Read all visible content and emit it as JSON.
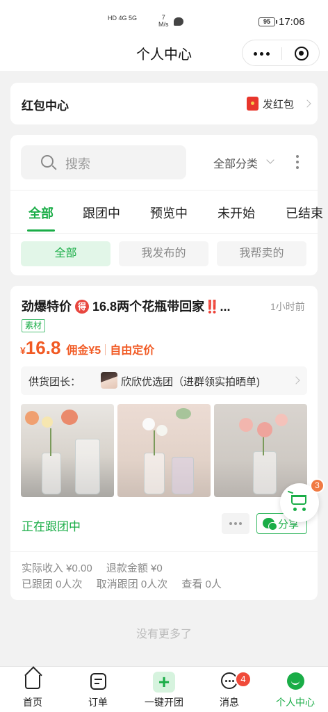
{
  "status_bar": {
    "network": "HD 4G 5G",
    "speed_value": "7",
    "speed_unit": "M/s",
    "battery": "95",
    "time": "17:06"
  },
  "nav": {
    "title": "个人中心",
    "more_icon": "more-dots-icon",
    "close_icon": "target-icon"
  },
  "red_packet": {
    "title": "红包中心",
    "action": "发红包",
    "icon": "red-packet-icon"
  },
  "filter": {
    "search_placeholder": "搜索",
    "category": "全部分类",
    "tabs": [
      "全部",
      "跟团中",
      "预览中",
      "未开始",
      "已结束"
    ],
    "active_tab": 0,
    "pills": [
      "全部",
      "我发布的",
      "我帮卖的"
    ],
    "active_pill": 0
  },
  "item": {
    "title_prefix": "劲爆特价",
    "title_badge": "得",
    "title_rest": "16.8两个花瓶带回家‼️...",
    "time_ago": "1小时前",
    "tag": "素材",
    "price_symbol": "¥",
    "price": "16.8",
    "commission": "佣金¥5",
    "pricing": "自由定价",
    "supplier_label": "供货团长：",
    "supplier_name": "欣欣优选团（进群领实拍晒单)",
    "status": "正在跟团中",
    "share_label": "分享",
    "stats": {
      "income": "实际收入 ¥0.00",
      "refund": "退款金额 ¥0",
      "joined": "已跟团 0人次",
      "cancelled": "取消跟团 0人次",
      "views": "查看 0人"
    }
  },
  "cart": {
    "count": "3",
    "icon": "cart-icon"
  },
  "no_more": "没有更多了",
  "tabbar": {
    "items": [
      {
        "label": "首页",
        "icon": "home-icon"
      },
      {
        "label": "订单",
        "icon": "order-icon"
      },
      {
        "label": "一键开团",
        "icon": "plus-icon"
      },
      {
        "label": "消息",
        "icon": "message-icon"
      },
      {
        "label": "个人中心",
        "icon": "profile-icon"
      }
    ],
    "active": 4,
    "message_badge": "4"
  },
  "colors": {
    "accent_green": "#1aad47",
    "price_orange": "#f15a24",
    "badge_red": "#f04a3a"
  }
}
